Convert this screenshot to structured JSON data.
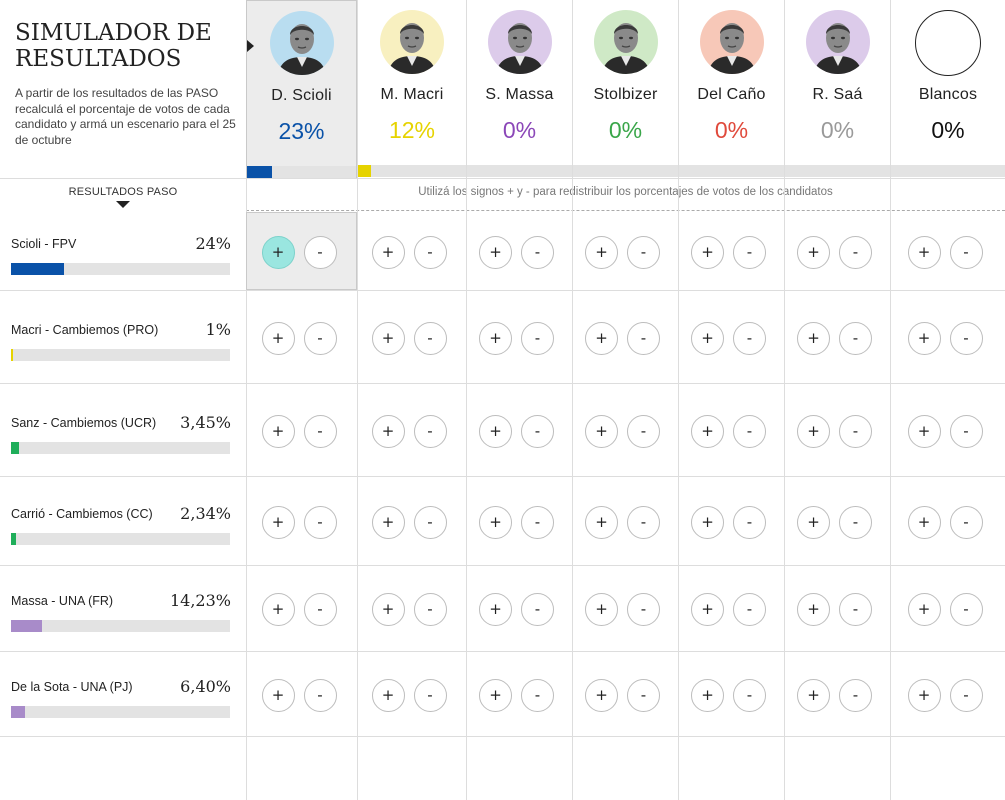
{
  "header": {
    "title": "SIMULADOR DE RESULTADOS",
    "subtitle": "A partir de los resultados de las PASO recalculá el porcentaje de votos de cada candidato y armá un escenario para el 25 de octubre"
  },
  "candidates": [
    {
      "name": "D. Scioli",
      "pct": "23%",
      "share": 0.23,
      "color": "#0a52a8",
      "avatar_bg": "#b9ddf0",
      "selected": true
    },
    {
      "name": "M. Macri",
      "pct": "12%",
      "share": 0.12,
      "color": "#e6d300",
      "avatar_bg": "#f8f0c0",
      "selected": false
    },
    {
      "name": "S. Massa",
      "pct": "0%",
      "share": 0,
      "color": "#8b47b8",
      "avatar_bg": "#dccbea",
      "selected": false
    },
    {
      "name": "Stolbizer",
      "pct": "0%",
      "share": 0,
      "color": "#3aa64a",
      "avatar_bg": "#cfe9c6",
      "selected": false
    },
    {
      "name": "Del Caño",
      "pct": "0%",
      "share": 0,
      "color": "#e04a3c",
      "avatar_bg": "#f7c8b8",
      "selected": false
    },
    {
      "name": "R. Saá",
      "pct": "0%",
      "share": 0,
      "color": "#9a9a9a",
      "avatar_bg": "#dccbea",
      "selected": false
    },
    {
      "name": "Blancos",
      "pct": "0%",
      "share": 0,
      "color": "#111111",
      "avatar_bg": "#ffffff",
      "selected": false
    }
  ],
  "paso": {
    "label": "RESULTADOS PASO",
    "hint": "Utilizá los signos + y - para redistribuir los porcentajes de votos de los candidatos",
    "parties": [
      {
        "name": "Scioli - FPV",
        "pct": "24%",
        "share": 0.24,
        "color": "#0a52a8"
      },
      {
        "name": "Macri - Cambiemos (PRO)",
        "pct": "1%",
        "share": 0.01,
        "color": "#e6d300"
      },
      {
        "name": "Sanz - Cambiemos (UCR)",
        "pct": "3,45%",
        "share": 0.0345,
        "color": "#1fae5a"
      },
      {
        "name": "Carrió - Cambiemos (CC)",
        "pct": "2,34%",
        "share": 0.0234,
        "color": "#1fae5a"
      },
      {
        "name": "Massa - UNA (FR)",
        "pct": "14,23%",
        "share": 0.1423,
        "color": "#a88bc9"
      },
      {
        "name": "De la Sota - UNA (PJ)",
        "pct": "6,40%",
        "share": 0.064,
        "color": "#a88bc9"
      }
    ]
  },
  "buttons": {
    "plus": "+",
    "minus": "-"
  },
  "icons": {
    "selected_arrow": "caret-right-icon",
    "paso_arrow": "caret-down-icon"
  }
}
